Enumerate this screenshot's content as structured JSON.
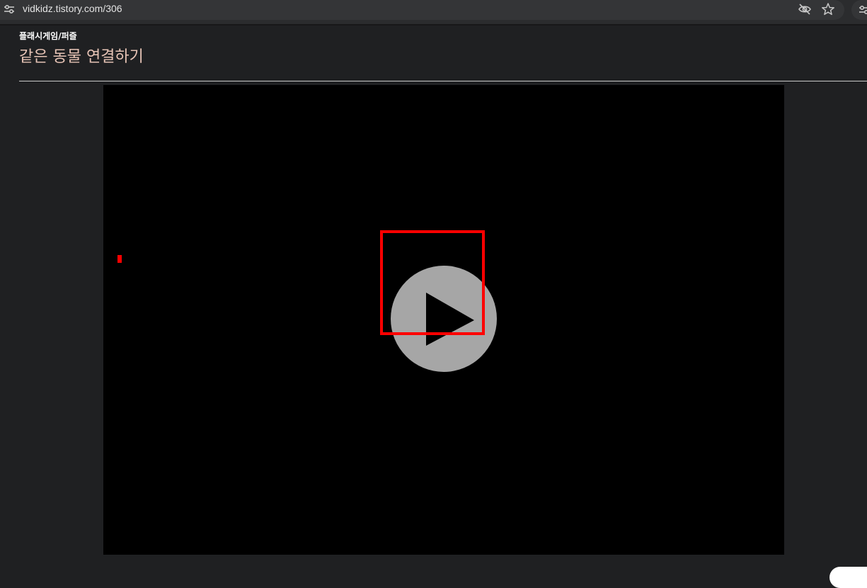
{
  "browser": {
    "url": "vidkidz.tistory.com/306",
    "icons": {
      "site_settings": "tune-icon",
      "tracking": "eye-off-icon",
      "bookmark": "star-icon",
      "extensions": "extensions-icon"
    }
  },
  "post": {
    "category": "플래시게임/퍼즐",
    "title": "같은 동물 연결하기"
  },
  "player": {
    "play_icon": "play-icon"
  },
  "colors": {
    "page_bg": "#1f2022",
    "title": "#e6c3b5",
    "player_bg": "#000000",
    "play_circle": "#a6a6a6",
    "highlight": "#ff0000"
  }
}
